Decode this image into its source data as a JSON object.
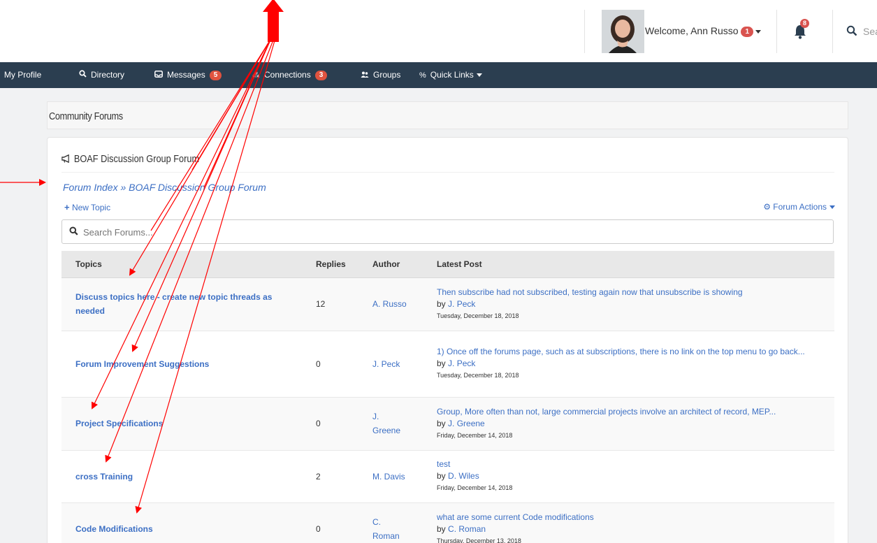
{
  "header": {
    "welcome_text": "Welcome, Ann Russo",
    "welcome_badge": "1",
    "notification_count": "8",
    "search_text": "Sear"
  },
  "nav": {
    "items": [
      {
        "label": "My Profile"
      },
      {
        "label": "Directory"
      },
      {
        "label": "Messages",
        "badge": "5"
      },
      {
        "label": "Connections",
        "badge": "3"
      },
      {
        "label": "Groups"
      },
      {
        "label": "Quick Links"
      }
    ]
  },
  "page": {
    "title": "Community Forums",
    "forum_title": "BOAF Discussion Group Forum",
    "breadcrumb_index": "Forum Index",
    "breadcrumb_sep": "»",
    "breadcrumb_current": "BOAF Discussion Group Forum",
    "new_topic": "New Topic",
    "forum_actions": "Forum Actions",
    "search_placeholder": "Search Forums..."
  },
  "table": {
    "headers": {
      "topics": "Topics",
      "replies": "Replies",
      "author": "Author",
      "latest": "Latest Post"
    },
    "rows": [
      {
        "topic": "Discuss topics here - create new topic threads as needed",
        "replies": "12",
        "author": "A. Russo",
        "latest": "Then subscribe had not subscribed, testing again now that unsubscribe is showing",
        "by": "J. Peck",
        "date": "Tuesday, December 18, 2018"
      },
      {
        "topic": "Forum Improvement Suggestions",
        "replies": "0",
        "author": "J. Peck",
        "latest": "1) Once off the forums page, such as at subscriptions, there is no link on the top menu to go back...",
        "by": "J. Peck",
        "date": "Tuesday, December 18, 2018"
      },
      {
        "topic": "Project Specifications",
        "replies": "0",
        "author": "J. Greene",
        "latest": "Group, More often than not, large commercial projects involve an architect of record, MEP...",
        "by": "J. Greene",
        "date": "Friday, December 14, 2018"
      },
      {
        "topic": "cross Training",
        "replies": "2",
        "author": "M. Davis",
        "latest": "test",
        "by": "D. Wiles",
        "date": "Friday, December 14, 2018"
      },
      {
        "topic": "Code Modifications",
        "replies": "0",
        "author": "C. Roman",
        "latest": "what are some current Code modifications",
        "by": "C. Roman",
        "date": "Thursday, December 13, 2018"
      }
    ],
    "by_prefix": "by"
  },
  "colors": {
    "navbar": "#2b3e50",
    "link": "#3c6fc4",
    "badge": "#d9534f",
    "annotation": "#ff0000"
  }
}
